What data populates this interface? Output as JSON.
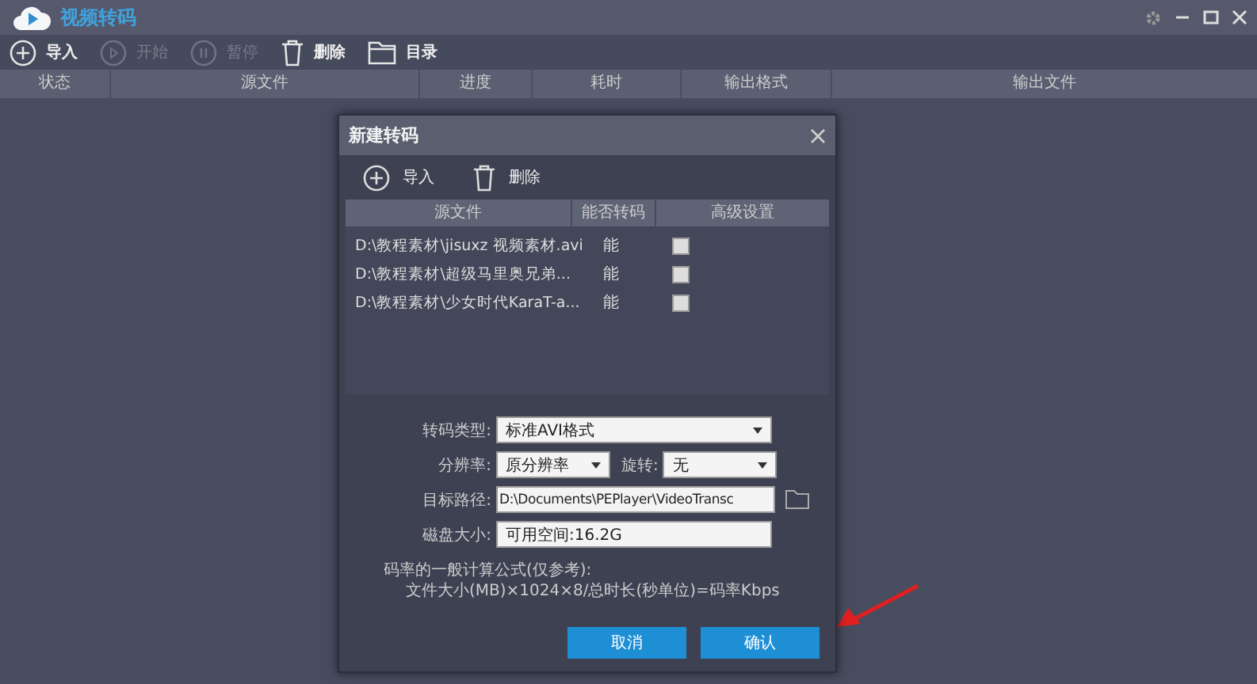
{
  "window": {
    "title": "视频转码"
  },
  "toolbar": [
    {
      "label": "导入",
      "kind": "plus",
      "disabled": false
    },
    {
      "label": "开始",
      "kind": "play",
      "disabled": true
    },
    {
      "label": "暂停",
      "kind": "pause",
      "disabled": true
    },
    {
      "label": "删除",
      "kind": "trash",
      "disabled": false
    },
    {
      "label": "目录",
      "kind": "folder",
      "disabled": false
    }
  ],
  "table": {
    "columns": [
      "状态",
      "源文件",
      "进度",
      "耗时",
      "输出格式",
      "输出文件"
    ]
  },
  "dialog": {
    "title": "新建转码",
    "toolbar": [
      {
        "label": "导入",
        "kind": "plus"
      },
      {
        "label": "删除",
        "kind": "trash"
      }
    ],
    "columns": [
      "源文件",
      "能否转码",
      "高级设置"
    ],
    "rows": [
      {
        "file": "D:\\教程素材\\jisuxz 视频素材.avi",
        "convertible": "能",
        "checked": false
      },
      {
        "file": "D:\\教程素材\\超级马里奥兄弟...",
        "convertible": "能",
        "checked": false
      },
      {
        "file": "D:\\教程素材\\少女时代KaraT-a...",
        "convertible": "能",
        "checked": false
      }
    ],
    "form": {
      "format_label": "转码类型:",
      "format": "标准AVI格式",
      "resolution_label": "分辨率:",
      "resolution": "原分辨率",
      "rotation_label": "旋转:",
      "rotation": "无",
      "path_label": "目标路径:",
      "path": "D:\\Documents\\PEPlayer\\VideoTransc",
      "disk_label": "磁盘大小:",
      "disk": "可用空间:16.2G"
    },
    "note": [
      "码率的一般计算公式(仅参考):",
      "文件大小(MB)×1024×8/总时长(秒单位)=码率Kbps"
    ],
    "buttons": [
      "取消",
      "确认"
    ]
  }
}
